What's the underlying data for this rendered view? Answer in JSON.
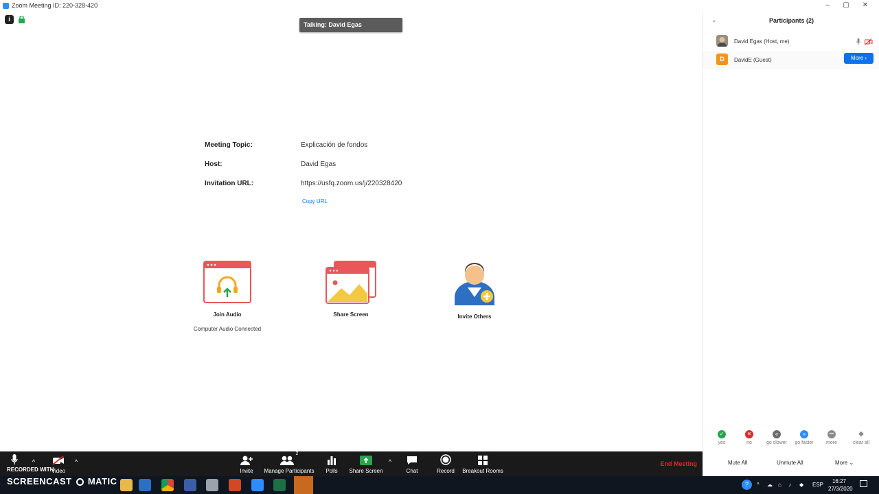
{
  "window": {
    "title": "Zoom Meeting ID: 220-328-420",
    "controls": [
      "–",
      "▢",
      "✕"
    ]
  },
  "talking": "Talking: David Egas",
  "meeting_info": {
    "topic_label": "Meeting Topic:",
    "topic_value": "Explicación de fondos",
    "host_label": "Host:",
    "host_value": "David Egas",
    "url_label": "Invitation URL:",
    "url_value": "https://usfq.zoom.us/j/220328420",
    "copy_url": "Copy URL"
  },
  "actions": {
    "join_audio": "Join Audio",
    "join_audio_status": "Computer Audio Connected",
    "share_screen": "Share Screen",
    "invite_others": "Invite Others"
  },
  "toolbar": {
    "video_label": "Video",
    "invite": "Invite",
    "manage_participants": "Manage Participants",
    "participant_count": "2",
    "polls": "Polls",
    "share_screen": "Share Screen",
    "chat": "Chat",
    "record": "Record",
    "breakout_rooms": "Breakout Rooms",
    "end_meeting": "End Meeting"
  },
  "participants_panel": {
    "title": "Participants (2)",
    "participants": [
      {
        "name": "David Egas (Host, me)"
      },
      {
        "name": "DavidE (Guest)",
        "initial": "D",
        "action": "More"
      }
    ],
    "feedback": [
      {
        "label": "yes",
        "color": "#2aa44f",
        "icon": "✓"
      },
      {
        "label": "no",
        "color": "#e02828",
        "icon": "✕"
      },
      {
        "label": "go slower",
        "color": "#6b6b6b",
        "icon": "«"
      },
      {
        "label": "go faster",
        "color": "#2d8cff",
        "icon": "»"
      },
      {
        "label": "more",
        "color": "#8a8a8a",
        "icon": "•••"
      },
      {
        "label": "clear all",
        "color": "#8a8a8a",
        "icon": "◆"
      }
    ],
    "mute_all": "Mute All",
    "unmute_all": "Unmute All",
    "more": "More"
  },
  "watermark": {
    "line1": "RECORDED WITH",
    "line2": "SCREENCAST",
    "line3": "MATIC"
  },
  "taskbar": {
    "lang": "ESP",
    "time": "16:27",
    "date": "27/3/2020"
  },
  "colors": {
    "accent": "#0e71eb",
    "end": "#e02828",
    "toolbar_bg": "#1a1a1a",
    "audio_icon": "#e8575a"
  }
}
